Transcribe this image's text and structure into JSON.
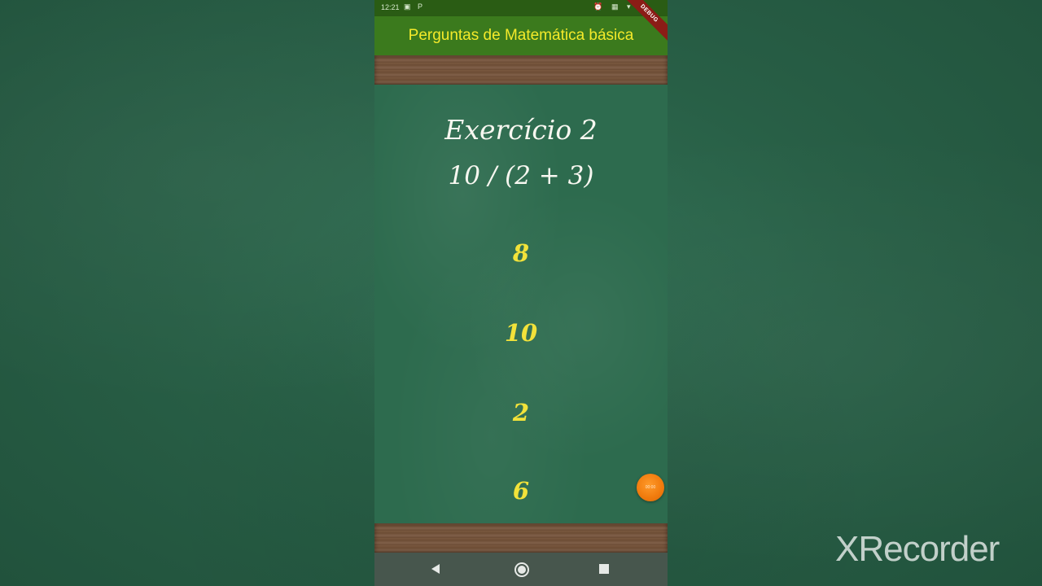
{
  "status_bar": {
    "time": "12:21",
    "left_icons": "▣ P",
    "right_icons": "⏰ ▦ ▾ ▮"
  },
  "debug_banner": "DEBUG",
  "app_bar": {
    "title": "Perguntas de Matemática básica"
  },
  "question": {
    "title": "Exercício 2",
    "expression": "10 / (2 + 3)"
  },
  "answers": [
    {
      "label": "8"
    },
    {
      "label": "10"
    },
    {
      "label": "2"
    },
    {
      "label": "6"
    }
  ],
  "timer": {
    "text": "00:00"
  },
  "nav": {
    "back_icon": "back-triangle-icon",
    "home_icon": "home-circle-icon",
    "recents_icon": "recents-square-icon"
  },
  "watermark": {
    "text": "XRecorder"
  },
  "colors": {
    "app_bar": "#3b7a1d",
    "title_text": "#f4ea2a",
    "answer_text": "#f2e23a",
    "chalk_text": "#f7f7f0",
    "board": "#2d6b4e",
    "timer": "#f07a0c"
  }
}
